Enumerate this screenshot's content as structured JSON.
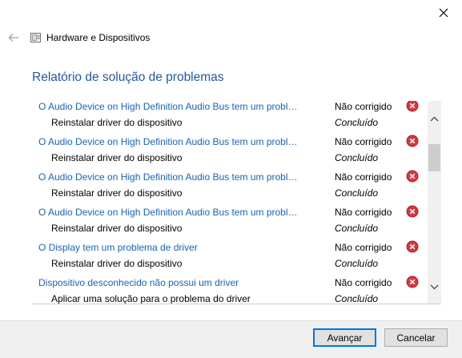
{
  "nav": {
    "title": "Hardware e Dispositivos"
  },
  "main": {
    "heading": "Relatório de solução de problemas"
  },
  "rows": [
    {
      "title": "O Audio Device on High Definition Audio Bus tem um problema de driver",
      "action": "Reinstalar driver do dispositivo",
      "status": "Não corrigido",
      "result": "Concluído"
    },
    {
      "title": "O Audio Device on High Definition Audio Bus tem um problema de driver",
      "action": "Reinstalar driver do dispositivo",
      "status": "Não corrigido",
      "result": "Concluído"
    },
    {
      "title": "O Audio Device on High Definition Audio Bus tem um problema de driver",
      "action": "Reinstalar driver do dispositivo",
      "status": "Não corrigido",
      "result": "Concluído"
    },
    {
      "title": "O Audio Device on High Definition Audio Bus tem um problema de driver",
      "action": "Reinstalar driver do dispositivo",
      "status": "Não corrigido",
      "result": "Concluído"
    },
    {
      "title": "O Display tem um problema de driver",
      "action": "Reinstalar driver do dispositivo",
      "status": "Não corrigido",
      "result": "Concluído"
    },
    {
      "title": "Dispositivo desconhecido não possui um driver",
      "action": "Aplicar uma solução para o problema do driver",
      "status": "Não corrigido",
      "result": "Concluído"
    }
  ],
  "footer": {
    "next_label": "Avançar",
    "cancel_label": "Cancelar"
  },
  "colors": {
    "link": "#1a64b4",
    "heading": "#1e5aa0",
    "error": "#d9363e",
    "primary_border": "#0078d7"
  },
  "icons": {
    "close": "close-icon",
    "back": "back-arrow-icon",
    "wizard": "troubleshooter-icon",
    "status": "error-x-icon",
    "scroll_up": "chevron-up-icon",
    "scroll_down": "chevron-down-icon"
  }
}
